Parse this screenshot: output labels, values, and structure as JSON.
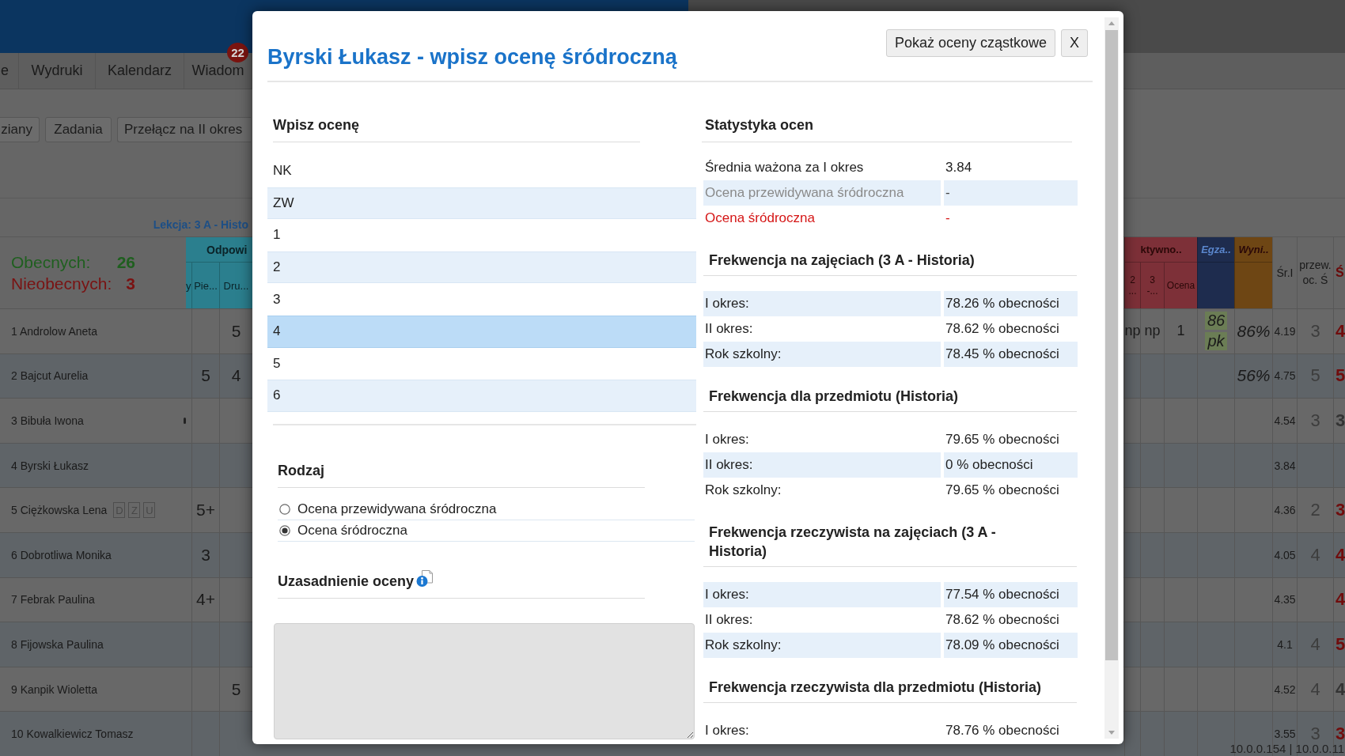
{
  "nav_items": [
    {
      "label": "e"
    },
    {
      "label": "Wydruki"
    },
    {
      "label": "Kalendarz"
    },
    {
      "label": "Wiadom",
      "badge": "22"
    }
  ],
  "toolbar_buttons": [
    "ziany",
    "Zadania",
    "Przełącz na II okres"
  ],
  "lesson_label": "Lekcja: 3 A - Histo",
  "gradebook": {
    "present_label": "Obecnych:",
    "present_count": "26",
    "absent_label": "Nieobecnych:",
    "absent_count": "3",
    "left_group": "Odpowi",
    "left_columns": [
      "y",
      "Pie...",
      "Dru..."
    ],
    "right_groups": [
      {
        "label": "ktywno..",
        "color": "#7d3038",
        "columns": [
          "2 ...",
          "3 -...",
          "Ocena"
        ]
      },
      {
        "label": "Egza..",
        "color": "#1e2c4e"
      },
      {
        "label": "Wyni..",
        "color": "#6e4614"
      }
    ],
    "plain_columns": [
      "Śr.I",
      "przew. oc. Ś"
    ],
    "final_column": "Ś",
    "rows": [
      {
        "name": "1 Androlow Aneta",
        "marked": false,
        "column_3": "5",
        "activity": [
          "np",
          "np",
          "1"
        ],
        "exam": [
          "86",
          "pk"
        ],
        "result": "86%",
        "average": "4.19",
        "predicted": "3",
        "final": {
          "text": "4",
          "color": "#700c0c"
        }
      },
      {
        "name": "2 Bajcut Aurelia",
        "marked": false,
        "column_2": "5",
        "column_3": "4",
        "result": "56%",
        "average": "4.75",
        "predicted": "5",
        "final": {
          "text": "5",
          "color": "#700c0c"
        }
      },
      {
        "name": "3 Bibuła Iwona",
        "marked": true,
        "average": "4.54",
        "predicted": "3",
        "final": {
          "text": "3",
          "color": "#333333"
        }
      },
      {
        "name": "4 Byrski Łukasz",
        "marked": false,
        "average": "3.84"
      },
      {
        "name": "5 Ciężkowska Lena",
        "marked": false,
        "tags": [
          "D",
          "Z",
          "U"
        ],
        "column_2": "5+",
        "average": "4.36",
        "predicted": "2",
        "final": {
          "text": "3",
          "color": "#700c0c"
        }
      },
      {
        "name": "6 Dobrotliwa Monika",
        "marked": false,
        "column_2": "3",
        "average": "4.05",
        "predicted": "4",
        "final": {
          "text": "4",
          "color": "#700c0c"
        }
      },
      {
        "name": "7 Febrak Paulina",
        "marked": false,
        "column_2": "4+",
        "average": "4.35",
        "final": {
          "text": "4",
          "color": "#700c0c"
        }
      },
      {
        "name": "8 Fijowska Paulina",
        "marked": false,
        "average": "4.1",
        "predicted": "4",
        "final": {
          "text": "5",
          "color": "#700c0c"
        }
      },
      {
        "name": "9 Kanpik Wioletta",
        "marked": false,
        "column_3": "5",
        "average": "4.52",
        "predicted": "4",
        "final": {
          "text": "4",
          "color": "#333333"
        }
      },
      {
        "name": "10 Kowalkiewicz Tomasz",
        "marked": false,
        "average": "3.55",
        "predicted": "3",
        "final": {
          "text": "3",
          "color": "#700c0c"
        }
      }
    ]
  },
  "server_info": "10.0.0.154 | 10.0.0.11",
  "dialog": {
    "title": "Byrski Łukasz - wpisz ocenę śródroczną",
    "show_grades_button": "Pokaż oceny cząstkowe",
    "close_button": "X",
    "grade_entry": {
      "heading": "Wpisz ocenę",
      "options": [
        {
          "label": "NK",
          "selected": false
        },
        {
          "label": "ZW",
          "selected": false
        },
        {
          "label": "1",
          "selected": false
        },
        {
          "label": "2",
          "selected": false
        },
        {
          "label": "3",
          "selected": false
        },
        {
          "label": "4",
          "selected": true
        },
        {
          "label": "5",
          "selected": false
        },
        {
          "label": "6",
          "selected": false
        }
      ]
    },
    "grade_type": {
      "heading": "Rodzaj",
      "options": [
        {
          "label": "Ocena przewidywana śródroczna",
          "selected": false
        },
        {
          "label": "Ocena śródroczna",
          "selected": true
        }
      ]
    },
    "justification": {
      "heading": "Uzasadnienie oceny"
    },
    "statistics": {
      "heading": "Statystyka ocen",
      "rows": [
        {
          "label": "Średnia ważona za I okres",
          "value": "3.84",
          "kind": "normal"
        },
        {
          "label": "Ocena przewidywana śródroczna",
          "value": "-",
          "kind": "muted"
        },
        {
          "label": "Ocena śródroczna",
          "value": "-",
          "kind": "alert"
        }
      ]
    },
    "attendance": [
      {
        "heading": "Frekwencja na zajęciach (3 A - Historia)",
        "rows": [
          {
            "label": "I okres:",
            "value": "78.26 % obecności"
          },
          {
            "label": "II okres:",
            "value": "78.62 % obecności"
          },
          {
            "label": "Rok szkolny:",
            "value": "78.45 % obecności"
          }
        ]
      },
      {
        "heading": "Frekwencja dla przedmiotu (Historia)",
        "rows": [
          {
            "label": "I okres:",
            "value": "79.65 % obecności"
          },
          {
            "label": "II okres:",
            "value": "0 % obecności"
          },
          {
            "label": "Rok szkolny:",
            "value": "79.65 % obecności"
          }
        ]
      },
      {
        "heading": "Frekwencja rzeczywista na zajęciach (3 A - Historia)",
        "rows": [
          {
            "label": "I okres:",
            "value": "77.54 % obecności"
          },
          {
            "label": "II okres:",
            "value": "78.62 % obecności"
          },
          {
            "label": "Rok szkolny:",
            "value": "78.09 % obecności"
          }
        ]
      },
      {
        "heading": "Frekwencja rzeczywista dla przedmiotu (Historia)",
        "rows": [
          {
            "label": "I okres:",
            "value": "78.76 % obecności"
          }
        ]
      }
    ]
  }
}
